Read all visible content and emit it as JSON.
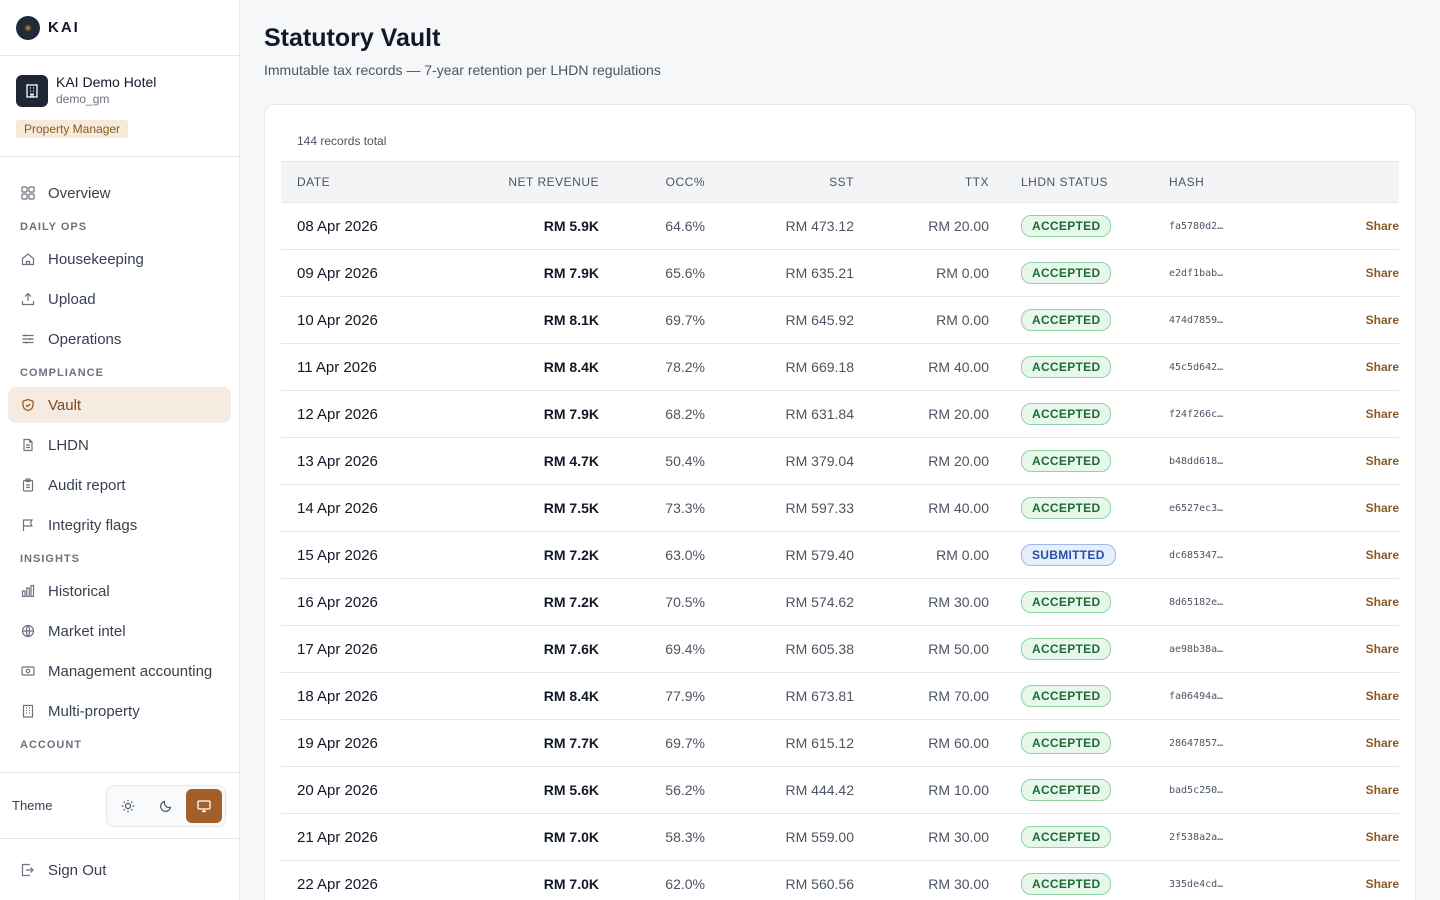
{
  "brand": {
    "name": "KAI"
  },
  "hotel": {
    "name": "KAI Demo Hotel",
    "user": "demo_gm",
    "role": "Property Manager"
  },
  "nav": {
    "overview": "Overview",
    "sections": {
      "daily_ops": "DAILY OPS",
      "compliance": "COMPLIANCE",
      "insights": "INSIGHTS",
      "account": "ACCOUNT"
    },
    "housekeeping": "Housekeeping",
    "upload": "Upload",
    "operations": "Operations",
    "vault": "Vault",
    "lhdn": "LHDN",
    "audit_report": "Audit report",
    "integrity_flags": "Integrity flags",
    "historical": "Historical",
    "market_intel": "Market intel",
    "management_accounting": "Management accounting",
    "multi_property": "Multi-property"
  },
  "theme": {
    "label": "Theme",
    "selected": "system"
  },
  "sign_out": "Sign Out",
  "page": {
    "title": "Statutory Vault",
    "subtitle": "Immutable tax records — 7-year retention per LHDN regulations",
    "records_total": "144 records total"
  },
  "table": {
    "headers": {
      "date": "DATE",
      "net_revenue": "NET REVENUE",
      "occ": "OCC%",
      "sst": "SST",
      "ttx": "TTX",
      "status": "LHDN STATUS",
      "hash": "HASH"
    },
    "share_label": "Share",
    "rows": [
      {
        "date": "08 Apr 2026",
        "rev": "RM 5.9K",
        "occ": "64.6%",
        "sst": "RM 473.12",
        "ttx": "RM 20.00",
        "status": "ACCEPTED",
        "hash": "fa5780d2…"
      },
      {
        "date": "09 Apr 2026",
        "rev": "RM 7.9K",
        "occ": "65.6%",
        "sst": "RM 635.21",
        "ttx": "RM 0.00",
        "status": "ACCEPTED",
        "hash": "e2df1bab…"
      },
      {
        "date": "10 Apr 2026",
        "rev": "RM 8.1K",
        "occ": "69.7%",
        "sst": "RM 645.92",
        "ttx": "RM 0.00",
        "status": "ACCEPTED",
        "hash": "474d7859…"
      },
      {
        "date": "11 Apr 2026",
        "rev": "RM 8.4K",
        "occ": "78.2%",
        "sst": "RM 669.18",
        "ttx": "RM 40.00",
        "status": "ACCEPTED",
        "hash": "45c5d642…"
      },
      {
        "date": "12 Apr 2026",
        "rev": "RM 7.9K",
        "occ": "68.2%",
        "sst": "RM 631.84",
        "ttx": "RM 20.00",
        "status": "ACCEPTED",
        "hash": "f24f266c…"
      },
      {
        "date": "13 Apr 2026",
        "rev": "RM 4.7K",
        "occ": "50.4%",
        "sst": "RM 379.04",
        "ttx": "RM 20.00",
        "status": "ACCEPTED",
        "hash": "b48dd618…"
      },
      {
        "date": "14 Apr 2026",
        "rev": "RM 7.5K",
        "occ": "73.3%",
        "sst": "RM 597.33",
        "ttx": "RM 40.00",
        "status": "ACCEPTED",
        "hash": "e6527ec3…"
      },
      {
        "date": "15 Apr 2026",
        "rev": "RM 7.2K",
        "occ": "63.0%",
        "sst": "RM 579.40",
        "ttx": "RM 0.00",
        "status": "SUBMITTED",
        "hash": "dc685347…"
      },
      {
        "date": "16 Apr 2026",
        "rev": "RM 7.2K",
        "occ": "70.5%",
        "sst": "RM 574.62",
        "ttx": "RM 30.00",
        "status": "ACCEPTED",
        "hash": "8d65182e…"
      },
      {
        "date": "17 Apr 2026",
        "rev": "RM 7.6K",
        "occ": "69.4%",
        "sst": "RM 605.38",
        "ttx": "RM 50.00",
        "status": "ACCEPTED",
        "hash": "ae98b38a…"
      },
      {
        "date": "18 Apr 2026",
        "rev": "RM 8.4K",
        "occ": "77.9%",
        "sst": "RM 673.81",
        "ttx": "RM 70.00",
        "status": "ACCEPTED",
        "hash": "fa06494a…"
      },
      {
        "date": "19 Apr 2026",
        "rev": "RM 7.7K",
        "occ": "69.7%",
        "sst": "RM 615.12",
        "ttx": "RM 60.00",
        "status": "ACCEPTED",
        "hash": "28647857…"
      },
      {
        "date": "20 Apr 2026",
        "rev": "RM 5.6K",
        "occ": "56.2%",
        "sst": "RM 444.42",
        "ttx": "RM 10.00",
        "status": "ACCEPTED",
        "hash": "bad5c250…"
      },
      {
        "date": "21 Apr 2026",
        "rev": "RM 7.0K",
        "occ": "58.3%",
        "sst": "RM 559.00",
        "ttx": "RM 30.00",
        "status": "ACCEPTED",
        "hash": "2f538a2a…"
      },
      {
        "date": "22 Apr 2026",
        "rev": "RM 7.0K",
        "occ": "62.0%",
        "sst": "RM 560.56",
        "ttx": "RM 30.00",
        "status": "ACCEPTED",
        "hash": "335de4cd…"
      }
    ]
  },
  "colors": {
    "accent": "#a35f2a",
    "accepted": "#1e6b34",
    "submitted": "#2a4fa8"
  }
}
